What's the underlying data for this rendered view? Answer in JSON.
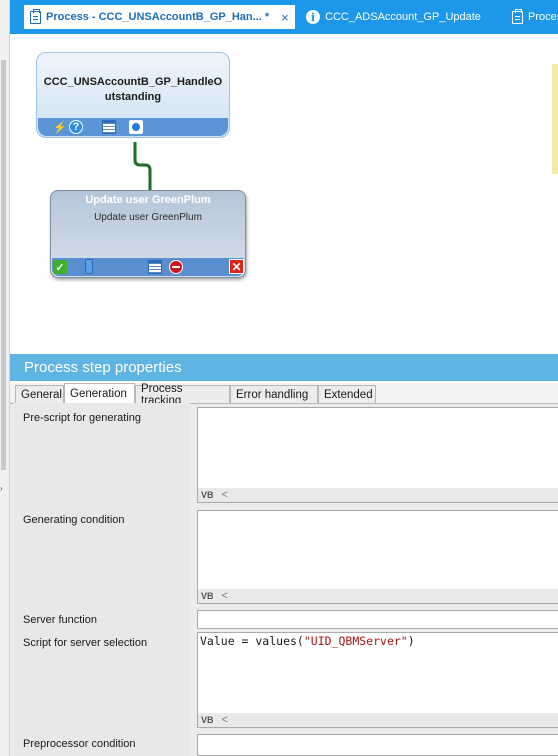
{
  "tabs": [
    {
      "label": "Process - CCC_UNSAccountB_GP_Han... *",
      "close": "×"
    },
    {
      "label": "CCC_ADSAccount_GP_Update",
      "info": "i"
    },
    {
      "label": "Proces"
    }
  ],
  "canvas": {
    "node1": {
      "title": "CCC_UNSAccountB_GP_HandleOutstanding"
    },
    "node2": {
      "title": "Update user GreenPlum",
      "subtitle": "Update user GreenPlum"
    }
  },
  "properties": {
    "header": "Process step properties",
    "tabs": [
      "General",
      "Generation",
      "Process tracking",
      "Error handling",
      "Extended"
    ],
    "active_tab": "Generation",
    "fields": [
      {
        "label": "Pre-script for generating",
        "value": "",
        "footer": "VB"
      },
      {
        "label": "Generating condition",
        "value": "",
        "footer": "VB"
      },
      {
        "label": "Server function",
        "value": ""
      },
      {
        "label": "Script for server selection",
        "code_prefix": "Value = values(",
        "code_string": "\"UID_QBMServer\"",
        "code_suffix": ")",
        "footer": "VB"
      },
      {
        "label": "Preprocessor condition",
        "value": ""
      }
    ],
    "footer_arrow": "<"
  }
}
